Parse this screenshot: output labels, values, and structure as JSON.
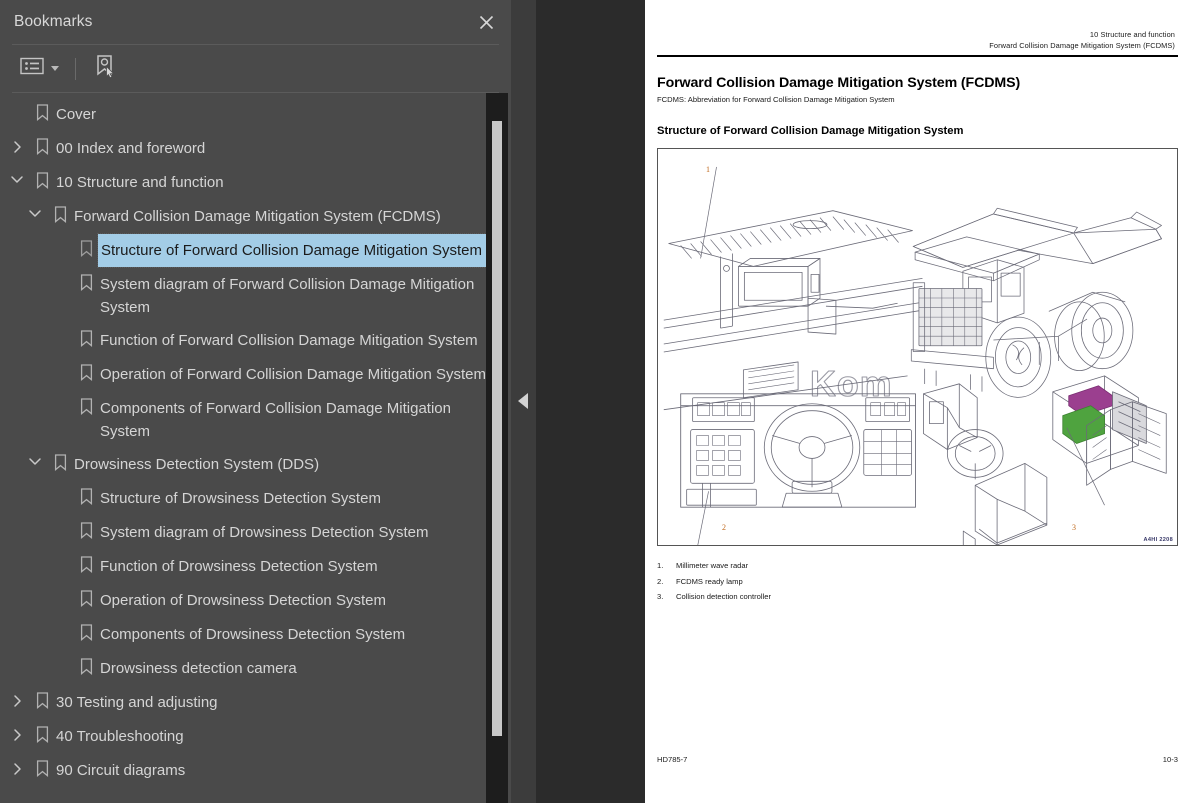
{
  "panel": {
    "title": "Bookmarks",
    "close_label": "×",
    "toolbar": {
      "options_icon": "list-options-icon",
      "options_label": "Bookmark options",
      "select_bookmark_icon": "bookmark-pointer-icon",
      "select_bookmark_label": "Select bookmark for current page"
    },
    "tree": [
      {
        "label": "Cover",
        "level": 0,
        "twisty": "none",
        "selected": false
      },
      {
        "label": "00 Index and foreword",
        "level": 0,
        "twisty": "collapsed",
        "selected": false
      },
      {
        "label": "10 Structure and function",
        "level": 0,
        "twisty": "expanded",
        "selected": false
      },
      {
        "label": "Forward Collision Damage Mitigation System (FCDMS)",
        "level": 1,
        "twisty": "expanded",
        "selected": false
      },
      {
        "label": "Structure of Forward Collision Damage Mitigation System",
        "level": 2,
        "twisty": "none",
        "selected": true
      },
      {
        "label": "System diagram of Forward Collision Damage Mitigation System",
        "level": 2,
        "twisty": "none",
        "selected": false
      },
      {
        "label": "Function of Forward Collision Damage Mitigation System",
        "level": 2,
        "twisty": "none",
        "selected": false
      },
      {
        "label": "Operation of Forward Collision Damage Mitigation System",
        "level": 2,
        "twisty": "none",
        "selected": false
      },
      {
        "label": "Components of Forward Collision Damage Mitigation System",
        "level": 2,
        "twisty": "none",
        "selected": false
      },
      {
        "label": "Drowsiness Detection System (DDS)",
        "level": 1,
        "twisty": "expanded",
        "selected": false
      },
      {
        "label": "Structure of Drowsiness Detection System",
        "level": 2,
        "twisty": "none",
        "selected": false
      },
      {
        "label": "System diagram of Drowsiness Detection System",
        "level": 2,
        "twisty": "none",
        "selected": false
      },
      {
        "label": "Function of Drowsiness Detection System",
        "level": 2,
        "twisty": "none",
        "selected": false
      },
      {
        "label": "Operation of Drowsiness Detection System",
        "level": 2,
        "twisty": "none",
        "selected": false
      },
      {
        "label": "Components of Drowsiness Detection System",
        "level": 2,
        "twisty": "none",
        "selected": false
      },
      {
        "label": "Drowsiness detection camera",
        "level": 2,
        "twisty": "none",
        "selected": false
      },
      {
        "label": "30 Testing and adjusting",
        "level": 0,
        "twisty": "collapsed",
        "selected": false
      },
      {
        "label": "40 Troubleshooting",
        "level": 0,
        "twisty": "collapsed",
        "selected": false
      },
      {
        "label": "90 Circuit diagrams",
        "level": 0,
        "twisty": "collapsed",
        "selected": false
      }
    ]
  },
  "gutter": {
    "collapse_icon": "collapse-left-triangle-icon"
  },
  "document": {
    "runhead_line1": "10 Structure and function",
    "runhead_line2": "Forward Collision Damage Mitigation System (FCDMS)",
    "heading": "Forward Collision Damage Mitigation System (FCDMS)",
    "subheading": "FCDMS: Abbreviation for Forward Collision Damage Mitigation System",
    "section_title": "Structure of Forward Collision Damage Mitigation System",
    "figure": {
      "code": "A4HI 2208",
      "callouts": [
        "1",
        "2",
        "3"
      ]
    },
    "legend": [
      {
        "num": "1.",
        "text": "Millimeter wave radar"
      },
      {
        "num": "2.",
        "text": "FCDMS ready lamp"
      },
      {
        "num": "3.",
        "text": "Collision detection controller"
      }
    ],
    "footer_left": "HD785-7",
    "footer_right": "10-3"
  },
  "colors": {
    "panel_bg": "#4a4a4a",
    "selection_bg": "#a3cde7",
    "gutter_bg": "#2b2b2b",
    "page_bg": "#ffffff",
    "callout": "#c06a1e"
  }
}
